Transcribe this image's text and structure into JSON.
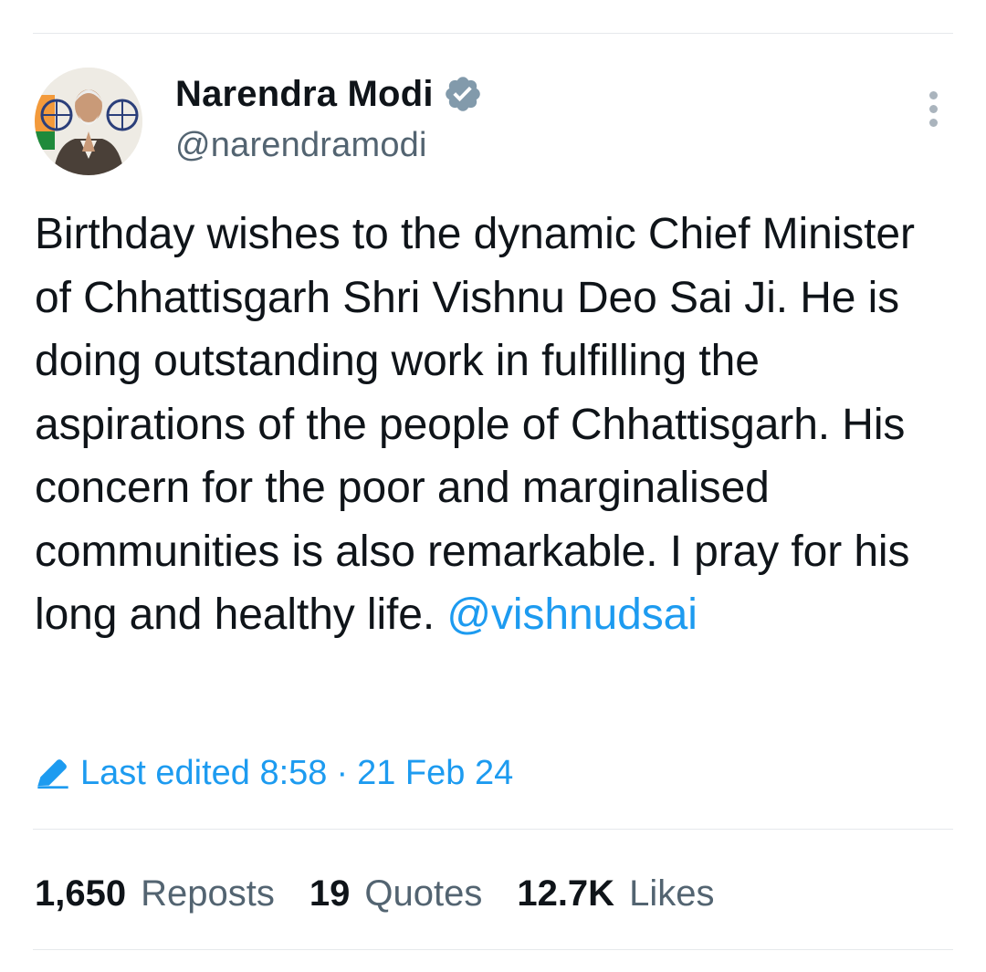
{
  "author": {
    "display_name": "Narendra Modi",
    "handle": "@narendramodi",
    "verified_icon": "verified-badge-icon",
    "badge_color": "#829aab"
  },
  "tweet": {
    "text": "Birthday wishes to the dynamic Chief Minister of Chhattisgarh Shri Vishnu Deo Sai Ji. He is doing outstanding work in fulfilling the aspirations of the people of Chhattisgarh. His concern for the poor and marginalised communities is also remarkable. I pray for his long and healthy life. ",
    "mention": "@vishnudsai"
  },
  "edited": {
    "label": "Last edited 8:58",
    "separator": "·",
    "date": "21 Feb 24",
    "icon": "pencil-icon"
  },
  "stats": [
    {
      "count": "1,650",
      "label": "Reposts"
    },
    {
      "count": "19",
      "label": "Quotes"
    },
    {
      "count": "12.7K",
      "label": "Likes"
    }
  ],
  "colors": {
    "link": "#1d9bf0",
    "secondary_text": "#536471",
    "primary_text": "#0f1419"
  }
}
